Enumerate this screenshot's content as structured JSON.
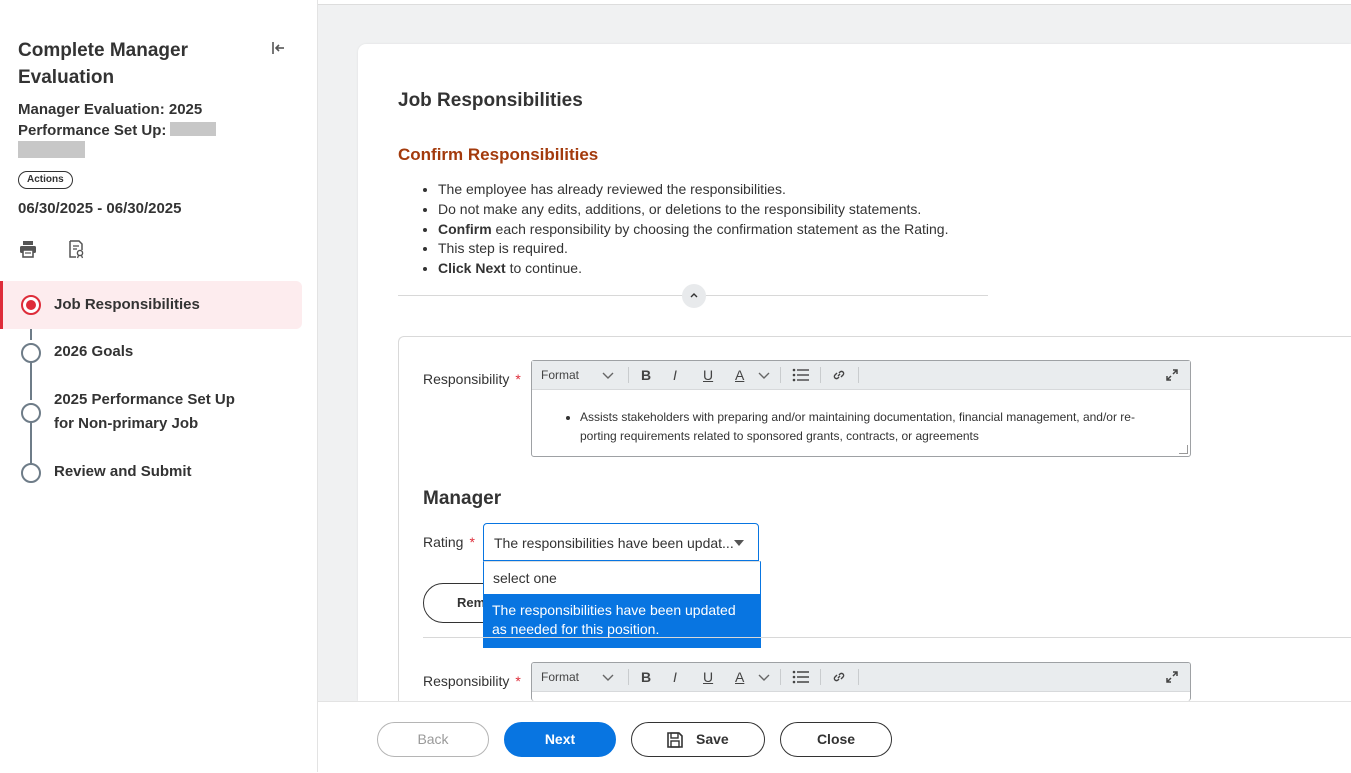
{
  "sidebar": {
    "title": "Complete Manager Evaluation",
    "subtitle_line1": "Manager Evaluation: 2025",
    "subtitle_line2": "Performance Set Up:",
    "actions_label": "Actions",
    "dates": "06/30/2025 - 06/30/2025",
    "steps": [
      {
        "label": "Job Responsibilities",
        "active": true
      },
      {
        "label": "2026 Goals",
        "active": false
      },
      {
        "label_line1": "2025 Performance Set Up",
        "label_line2": "for Non-primary Job",
        "active": false
      },
      {
        "label": "Review and Submit",
        "active": false
      }
    ]
  },
  "main": {
    "section_title": "Job Responsibilities",
    "confirm_title": "Confirm Responsibilities",
    "instructions": [
      {
        "bold": "",
        "text": "The employee has already reviewed the responsibilities."
      },
      {
        "bold": "",
        "text": "Do not make any edits, additions, or deletions to the responsibility statements."
      },
      {
        "bold": "Confirm",
        "text": " each responsibility by choosing the confirmation statement as the Rating."
      },
      {
        "bold": "",
        "text": "This step is required."
      },
      {
        "bold": "Click Next",
        "text": " to continue."
      }
    ],
    "collapse_glyph": "^",
    "responsibility_label": "Responsibility",
    "required_mark": "*",
    "editor": {
      "format_label": "Format",
      "bold_glyph": "B",
      "italic_glyph": "I",
      "underline_glyph": "U",
      "color_glyph": "A",
      "content": "Assists stakeholders with preparing and/or maintaining documentation, financial management, and/or re-porting requirements related to sponsored grants, contracts, or agreements"
    },
    "manager_title": "Manager",
    "rating_label": "Rating",
    "rating_value": "The responsibilities have been updat...",
    "dropdown_options": [
      "select one",
      "The responsibilities have been updated as needed for this position."
    ],
    "remove_label": "Remove"
  },
  "footer": {
    "back_label": "Back",
    "next_label": "Next",
    "save_label": "Save",
    "close_label": "Close"
  },
  "colors": {
    "accent_blue": "#0875e1",
    "active_red": "#de2d3a",
    "confirm_title": "#a33a0c"
  }
}
